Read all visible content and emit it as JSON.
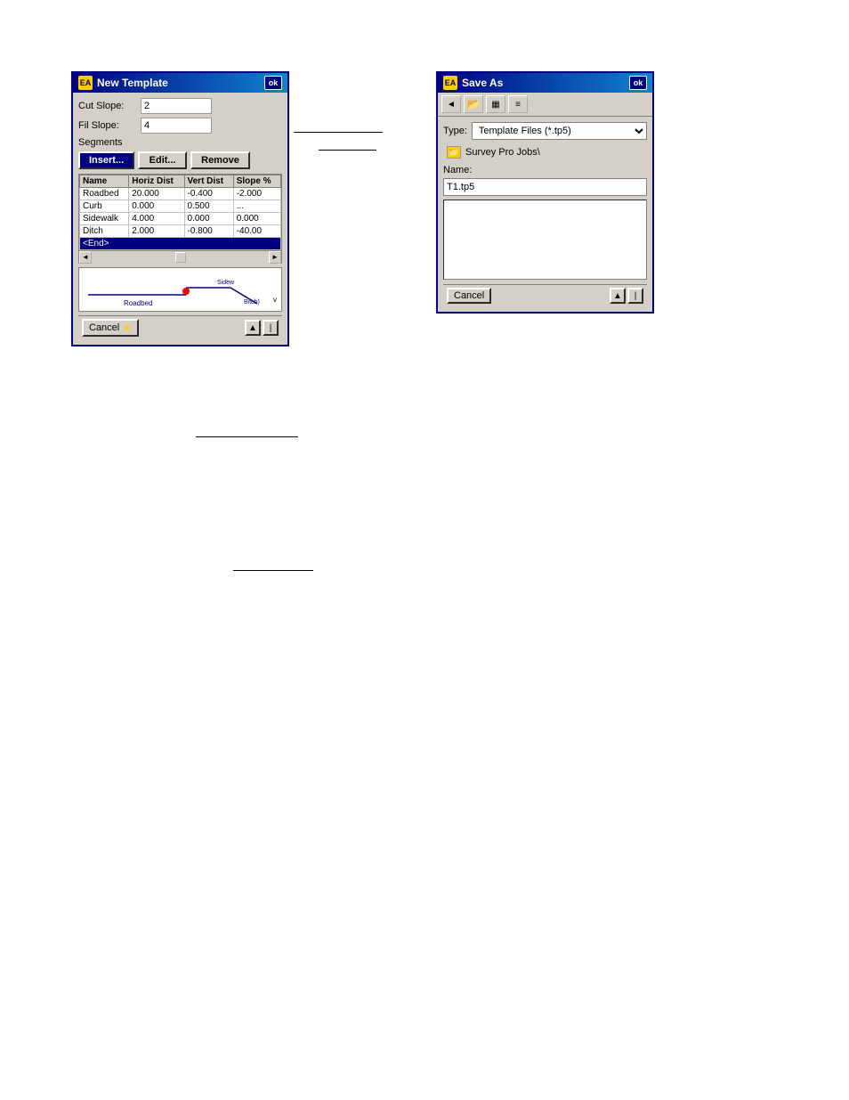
{
  "newTemplate": {
    "title": "New Template",
    "titleIcon": "EA",
    "okLabel": "ok",
    "cutSlope": {
      "label": "Cut Slope:",
      "value": "2"
    },
    "fillSlope": {
      "label": "Fil Slope:",
      "value": "4"
    },
    "segments": {
      "label": "Segments",
      "insertBtn": "Insert...",
      "editBtn": "Edit...",
      "removeBtn": "Remove",
      "columns": [
        "Name",
        "Horiz Dist",
        "Vert Dist",
        "Slope %"
      ],
      "rows": [
        {
          "name": "Roadbed",
          "horizDist": "20.000",
          "vertDist": "-0.400",
          "slope": "-2.000"
        },
        {
          "name": "Curb",
          "horizDist": "0.000",
          "vertDist": "0.500",
          "slope": "..."
        },
        {
          "name": "Sidewalk",
          "horizDist": "4.000",
          "vertDist": "0.000",
          "slope": "0.000"
        },
        {
          "name": "Ditch",
          "horizDist": "2.000",
          "vertDist": "-0.800",
          "slope": "-40.00"
        }
      ],
      "endRow": "<End>"
    },
    "preview": {
      "labels": [
        "Roadbed",
        "SidewBitch)"
      ]
    },
    "cancelBtn": "Cancel",
    "starIcon": "★",
    "upArrow": "▲",
    "downArrow": "▼"
  },
  "saveAs": {
    "title": "Save As",
    "titleIcon": "EA",
    "okLabel": "ok",
    "typeLabel": "Type:",
    "typeValue": "Template Files (*.tp5)",
    "folderName": "Survey Pro Jobs\\",
    "nameLabel": "Name:",
    "nameValue": "T1.tp5",
    "cancelBtn": "Cancel",
    "upArrow": "▲",
    "toolbar": {
      "backIcon": "←",
      "folderIcon": "📁",
      "gridIcon": "▦",
      "listIcon": "☰"
    }
  },
  "connectors": {
    "line1": "——————",
    "line2": "——————"
  }
}
